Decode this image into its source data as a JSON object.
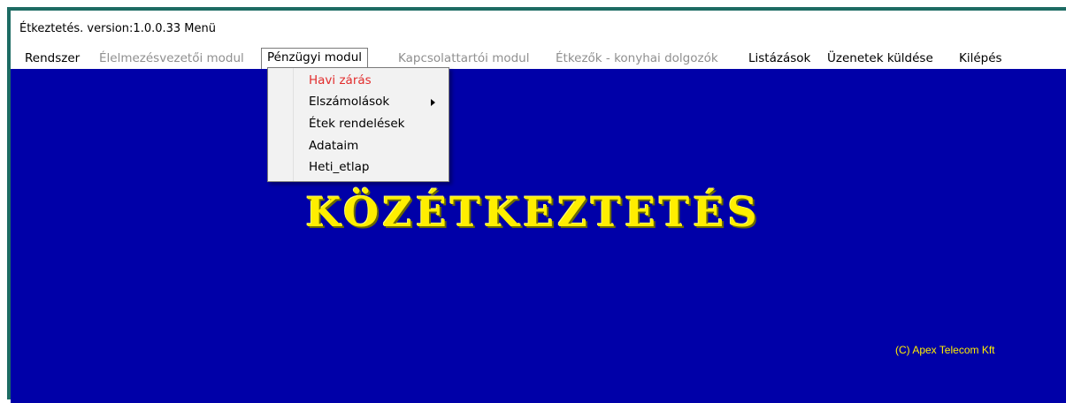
{
  "window": {
    "title": "Étkeztetés.  version:1.0.0.33  Menü"
  },
  "menubar": {
    "items": [
      {
        "label": "Rendszer",
        "enabled": true
      },
      {
        "label": "Élelmezésvezetői modul",
        "enabled": false
      },
      {
        "label": "Pénzügyi modul",
        "enabled": true,
        "active": true
      },
      {
        "label": "Kapcsolattartói modul",
        "enabled": false
      },
      {
        "label": "Étkezők - konyhai dolgozók",
        "enabled": false
      },
      {
        "label": "Listázások",
        "enabled": true
      },
      {
        "label": "Üzenetek küldése",
        "enabled": true
      },
      {
        "label": "Kilépés",
        "enabled": true
      }
    ]
  },
  "dropdown": {
    "items": [
      {
        "label": "Havi zárás",
        "highlighted": true
      },
      {
        "label": "Elszámolások",
        "has_submenu": true
      },
      {
        "label": "Étek rendelések"
      },
      {
        "label": "Adataim"
      },
      {
        "label": "Heti_etlap"
      }
    ]
  },
  "banner": {
    "text": "KÖZÉTKEZTETÉS"
  },
  "footer": {
    "copyright": "(C) Apex Telecom Kft"
  },
  "colors": {
    "background": "#0000a8",
    "banner": "#ffee00",
    "highlight": "#e22d2d",
    "disabled": "#8f8f8f"
  }
}
